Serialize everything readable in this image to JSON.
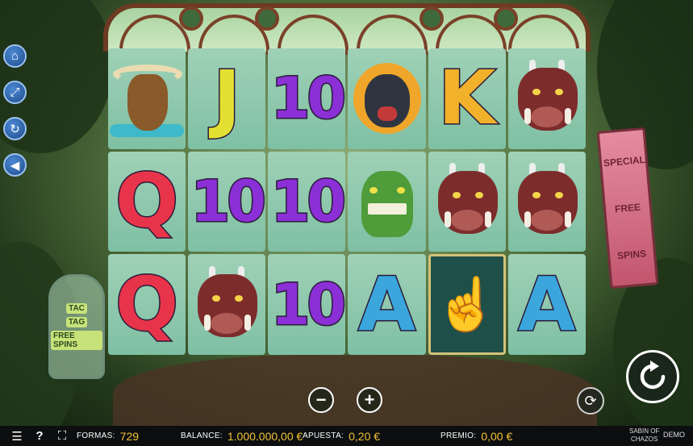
{
  "reels": [
    [
      "buffalo",
      "Q",
      "Q"
    ],
    [
      "J",
      "10",
      "boar"
    ],
    [
      "10",
      "10",
      "10"
    ],
    [
      "bear",
      "croc",
      "A"
    ],
    [
      "K",
      "boar",
      "hand"
    ],
    [
      "boar",
      "boar",
      "A"
    ]
  ],
  "letters": {
    "J": "J",
    "K": "K",
    "Q": "Q",
    "A": "A",
    "ten": "10"
  },
  "banner": {
    "line1": "SPECIAL",
    "line2": "FREE",
    "line3": "SPINS"
  },
  "jar": {
    "line1": "TAC",
    "line2": "TAG",
    "line3": "FREE SPINS"
  },
  "controls": {
    "minus": "−",
    "plus": "+"
  },
  "bottom_bar": {
    "formas_label": "FORMAS:",
    "formas_value": "729",
    "balance_label": "BALANCE:",
    "balance_value": "1.000.000,00 €",
    "apuesta_label": "APUESTA:",
    "apuesta_value": "0,20 €",
    "premio_label": "PREMIO:",
    "premio_value": "0,00 €",
    "brand_line1": "SABIN OF",
    "brand_line2": "CHAZOS",
    "mode": "DEMO"
  },
  "icons": {
    "side": [
      "home-icon",
      "fullscreen-icon",
      "refresh-icon",
      "sound-icon"
    ],
    "bottom": [
      "menu-icon",
      "help-icon",
      "expand-icon"
    ]
  },
  "colors": {
    "accent_value": "#f2c235",
    "side_button": "#2b6ab8",
    "bar_background": "#0c0e10"
  }
}
